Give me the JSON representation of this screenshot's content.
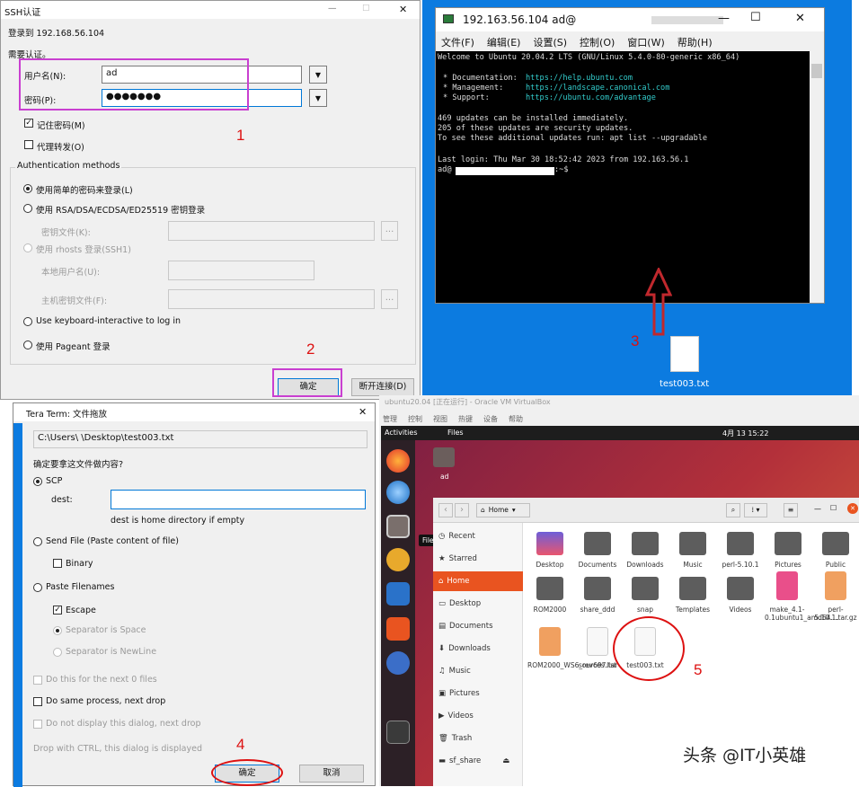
{
  "ssh": {
    "title": "SSH认证",
    "close": "✕",
    "min": "—",
    "max": "☐",
    "login_to": "登录到 192.168.56.104",
    "need_auth": "需要认证。",
    "user_label": "用户名(N):",
    "user_value": "ad",
    "pass_label": "密码(P):",
    "pass_value": "●●●●●●●",
    "remember": "记住密码(M)",
    "forward": "代理转发(O)",
    "auth_methods": "Authentication methods",
    "m1": "使用简单的密码来登录(L)",
    "m2": "使用 RSA/DSA/ECDSA/ED25519 密钥登录",
    "keyfile": "密钥文件(K):",
    "m3": "使用 rhosts 登录(SSH1)",
    "localuser": "本地用户名(U):",
    "hostkey": "主机密钥文件(F):",
    "m4": "Use keyboard-interactive to log in",
    "m5": "使用 Pageant 登录",
    "ok": "确定",
    "disconnect": "断开连接(D)",
    "browse": "..."
  },
  "terminal": {
    "title": "192.163.56.104  ad@",
    "menu": [
      "文件(F)",
      "编辑(E)",
      "设置(S)",
      "控制(O)",
      "窗口(W)",
      "帮助(H)"
    ],
    "lines": [
      "Welcome to Ubuntu 20.04.2 LTS (GNU/Linux 5.4.0-80-generic x86_64)",
      "",
      "* Documentation:",
      "* Management:",
      "* Support:",
      "",
      "469 updates can be installed immediately.",
      "205 of these updates are security updates.",
      "To see these additional updates run: apt list --upgradable",
      "",
      "Last login: Thu Mar 30 18:52:42 2023 from 192.163.56.1",
      "ad@"
    ],
    "links": [
      "https://help.ubuntu.com",
      "https://landscape.canonical.com",
      "https://ubuntu.com/advantage"
    ],
    "prompt_end": ":~$"
  },
  "desktop_file": "test003.txt",
  "tera": {
    "title": "Tera Term: 文件拖放",
    "path": "C:\\Users\\                    \\Desktop\\test003.txt",
    "question": "确定要拿这文件做内容?",
    "scp": "SCP",
    "dest_label": "dest:",
    "dest_hint": "dest is home directory if empty",
    "sendfile": "Send File (Paste content of file)",
    "binary": "Binary",
    "paste": "Paste Filenames",
    "escape": "Escape",
    "sep_space": "Separator is Space",
    "sep_newline": "Separator is NewLine",
    "next": "Do this for the next 0 files",
    "same": "Do same process, next drop",
    "nodisplay": "Do not display this dialog, next drop",
    "ctrl": "Drop with CTRL, this dialog is displayed",
    "ok": "确定",
    "cancel": "取消",
    "close": "✕"
  },
  "vbox": {
    "title": "ubuntu20.04 [正在运行] - Oracle VM VirtualBox",
    "menu": [
      "管理",
      "控制",
      "视图",
      "热键",
      "设备",
      "帮助"
    ]
  },
  "ubuntu": {
    "activities": "Activities",
    "files_app": "Files",
    "clock": "4月 13 15:22",
    "home_icon_label": "ad",
    "tooltip": "Files",
    "path": "Home",
    "sidebar": [
      "Recent",
      "Starred",
      "Home",
      "Desktop",
      "Documents",
      "Downloads",
      "Music",
      "Pictures",
      "Videos",
      "Trash",
      "sf_share"
    ],
    "items": [
      "Desktop",
      "Documents",
      "Downloads",
      "Music",
      "perl-5.10.1",
      "Pictures",
      "Public",
      "ROM2000",
      "share_ddd",
      "snap",
      "Templates",
      "Videos",
      "make_4.1-0.1ubuntu1_amd64....",
      "perl-5.10.1.tar.gz",
      "ROM2000_WS6_rev697.tar",
      "sources.list",
      "test003.txt"
    ],
    "colors": {
      "folder": "#5d5d5d",
      "orange": "#e95420",
      "pink": "#e94f8a",
      "tar": "#f0a060"
    }
  },
  "annot": {
    "n1": "1",
    "n2": "2",
    "n3": "3",
    "n4": "4",
    "n5": "5",
    "color": "#d11"
  },
  "watermark": "头条 @IT小英雄"
}
